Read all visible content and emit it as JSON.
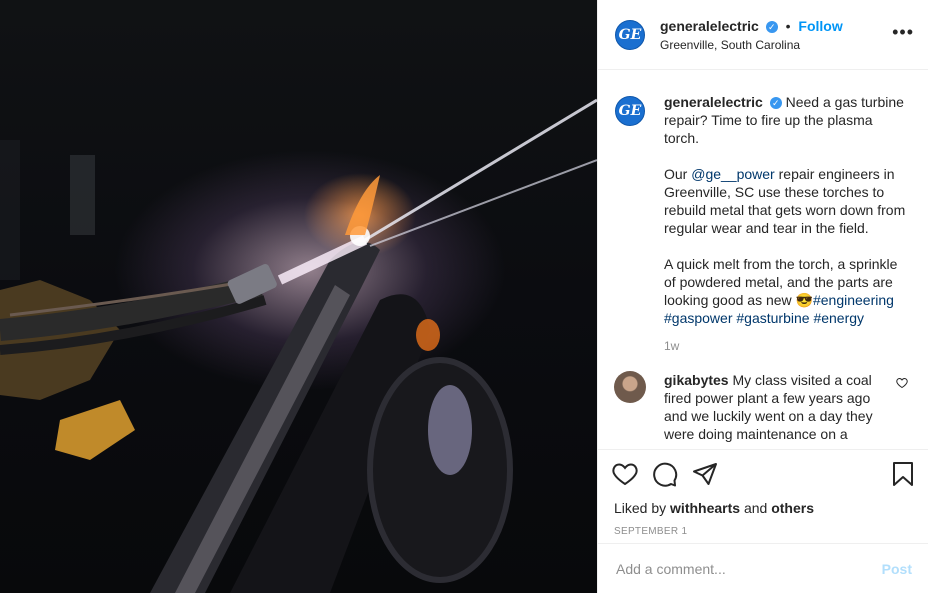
{
  "post": {
    "image_alt": "Plasma torch repairing gas turbine part",
    "user": "generalelectric",
    "follow_label": "Follow",
    "dot": "•",
    "location": "Greenville, South Carolina",
    "more_label": "•••",
    "logo_text": "GE"
  },
  "caption": {
    "user": "generalelectric",
    "p1": "Need a gas turbine repair? Time to fire up the plasma torch.",
    "p2_prefix": "Our ",
    "p2_mention": "@ge__power",
    "p2_rest": " repair engineers in Greenville, SC use these torches to rebuild metal that gets worn down from regular wear and tear in the field.",
    "p3_text": "A quick melt from the torch, a sprinkle of powdered metal, and the parts are looking good as new 😎",
    "tags": [
      "#engineering",
      "#gaspower",
      "#gasturbine",
      "#energy"
    ],
    "time": "1w"
  },
  "comment": {
    "user": "gikabytes",
    "text": "My class visited a coal fired power plant a few years ago and we luckily went on a day they were doing maintenance on a"
  },
  "likes": {
    "prefix": "Liked by ",
    "user": "withhearts",
    "mid": " and ",
    "others": "others"
  },
  "date": "SEPTEMBER 1",
  "add_comment": {
    "placeholder": "Add a comment...",
    "post_label": "Post"
  },
  "icons": {
    "like": "heart-icon",
    "comment": "comment-bubble-icon",
    "share": "paper-plane-icon",
    "save": "bookmark-icon"
  },
  "colors": {
    "follow": "#0095f6",
    "link": "#00376b",
    "verified": "#3897f0"
  }
}
